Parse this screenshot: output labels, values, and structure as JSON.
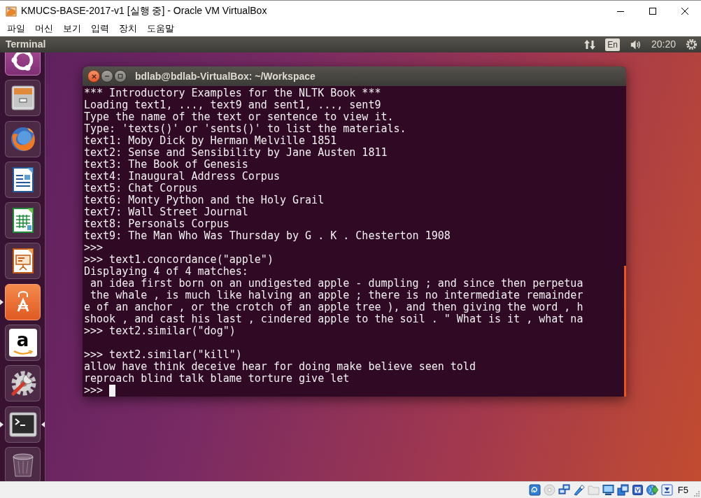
{
  "vbox_window": {
    "title": "KMUCS-BASE-2017-v1 [실행 중] - Oracle VM VirtualBox",
    "menu": [
      "파일",
      "머신",
      "보기",
      "입력",
      "장치",
      "도움말"
    ]
  },
  "top_panel": {
    "app_name": "Terminal",
    "keyboard_layout": "En",
    "clock": "20:20"
  },
  "launcher": {
    "items": [
      {
        "kind": "dash",
        "running": false,
        "focused": false
      },
      {
        "kind": "files",
        "running": false,
        "focused": false
      },
      {
        "kind": "browser",
        "running": false,
        "focused": false
      },
      {
        "kind": "document",
        "running": false,
        "focused": false
      },
      {
        "kind": "spreadsheet",
        "running": false,
        "focused": false
      },
      {
        "kind": "presentation",
        "running": false,
        "focused": false
      },
      {
        "kind": "software",
        "running": true,
        "focused": false
      },
      {
        "kind": "store",
        "label": "a",
        "running": false,
        "focused": false
      },
      {
        "kind": "settings",
        "running": false,
        "focused": false
      },
      {
        "kind": "terminal",
        "running": true,
        "focused": true
      },
      {
        "kind": "trash",
        "running": false,
        "focused": false
      }
    ]
  },
  "terminal": {
    "title": "bdlab@bdlab-VirtualBox: ~/Workspace",
    "cursor": true,
    "lines": [
      {
        "kind": "text",
        "text": "*** Introductory Examples for the NLTK Book ***"
      },
      {
        "kind": "text",
        "text": "Loading text1, ..., text9 and sent1, ..., sent9"
      },
      {
        "kind": "text",
        "text": "Type the name of the text or sentence to view it."
      },
      {
        "kind": "text",
        "text": "Type: 'texts()' or 'sents()' to list the materials."
      },
      {
        "kind": "text",
        "text": "text1: Moby Dick by Herman Melville 1851"
      },
      {
        "kind": "text",
        "text": "text2: Sense and Sensibility by Jane Austen 1811"
      },
      {
        "kind": "text",
        "text": "text3: The Book of Genesis"
      },
      {
        "kind": "text",
        "text": "text4: Inaugural Address Corpus"
      },
      {
        "kind": "text",
        "text": "text5: Chat Corpus"
      },
      {
        "kind": "text",
        "text": "text6: Monty Python and the Holy Grail"
      },
      {
        "kind": "text",
        "text": "text7: Wall Street Journal"
      },
      {
        "kind": "text",
        "text": "text8: Personals Corpus"
      },
      {
        "kind": "text",
        "text": "text9: The Man Who Was Thursday by G . K . Chesterton 1908"
      },
      {
        "kind": "text",
        "text": ">>>"
      },
      {
        "kind": "text",
        "text": ">>> text1.concordance(\"apple\")"
      },
      {
        "kind": "text",
        "text": "Displaying 4 of 4 matches:"
      },
      {
        "kind": "text",
        "text": " an idea first born on an undigested apple - dumpling ; and since then perpetua"
      },
      {
        "kind": "text",
        "text": " the whale , is much like halving an apple ; there is no intermediate remainder"
      },
      {
        "kind": "text",
        "text": "e of an anchor , or the crotch of an apple tree ), and then giving the word , h"
      },
      {
        "kind": "text",
        "text": "shook , and cast his last , cindered apple to the soil . \" What is it , what na"
      },
      {
        "kind": "text",
        "text": ">>> text2.similar(\"dog\")"
      },
      {
        "kind": "blank"
      },
      {
        "kind": "text",
        "text": ">>> text2.similar(\"kill\")"
      },
      {
        "kind": "text",
        "text": "allow have think deceive hear for doing make believe seen told"
      },
      {
        "kind": "text",
        "text": "reproach blind talk blame torture give let"
      },
      {
        "kind": "text",
        "text": ">>>"
      }
    ]
  },
  "status_bar": {
    "indicators": [
      {
        "kind": "hard-disk",
        "disabled": false
      },
      {
        "kind": "optical-disc",
        "disabled": true
      },
      {
        "kind": "network",
        "disabled": false
      },
      {
        "kind": "usb",
        "disabled": false
      },
      {
        "kind": "shared-folder",
        "disabled": true
      },
      {
        "kind": "display",
        "disabled": false
      },
      {
        "kind": "video-capture",
        "disabled": false
      },
      {
        "kind": "cpu",
        "disabled": false
      },
      {
        "kind": "mouse",
        "disabled": false
      },
      {
        "kind": "keyboard",
        "disabled": false
      }
    ],
    "host_key": "F5"
  }
}
